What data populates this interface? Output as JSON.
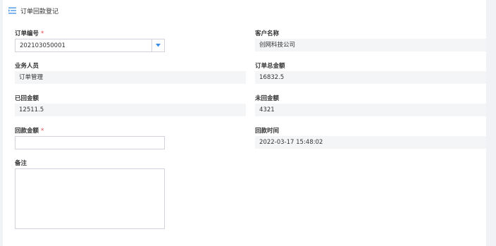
{
  "header": {
    "title": "订单回款登记",
    "icon": "menu-icon"
  },
  "colors": {
    "accent": "#3a8ee6",
    "required": "#e5484d",
    "readonly_bg": "#f4f5f7"
  },
  "form": {
    "order_no": {
      "label": "订单编号",
      "required_mark": "*",
      "value": "202103050001"
    },
    "customer_name": {
      "label": "客户名称",
      "value": "创网科技公司"
    },
    "salesperson": {
      "label": "业务人员",
      "value": "订单管理"
    },
    "order_total": {
      "label": "订单总金额",
      "value": "16832.5"
    },
    "received_amount": {
      "label": "已回金额",
      "value": "12511.5"
    },
    "unreceived_amount": {
      "label": "未回金额",
      "value": "4321"
    },
    "payment_amount": {
      "label": "回款金额",
      "required_mark": "*",
      "value": ""
    },
    "payment_time": {
      "label": "回款时间",
      "value": "2022-03-17 15:48:02"
    },
    "remark": {
      "label": "备注",
      "value": ""
    }
  }
}
